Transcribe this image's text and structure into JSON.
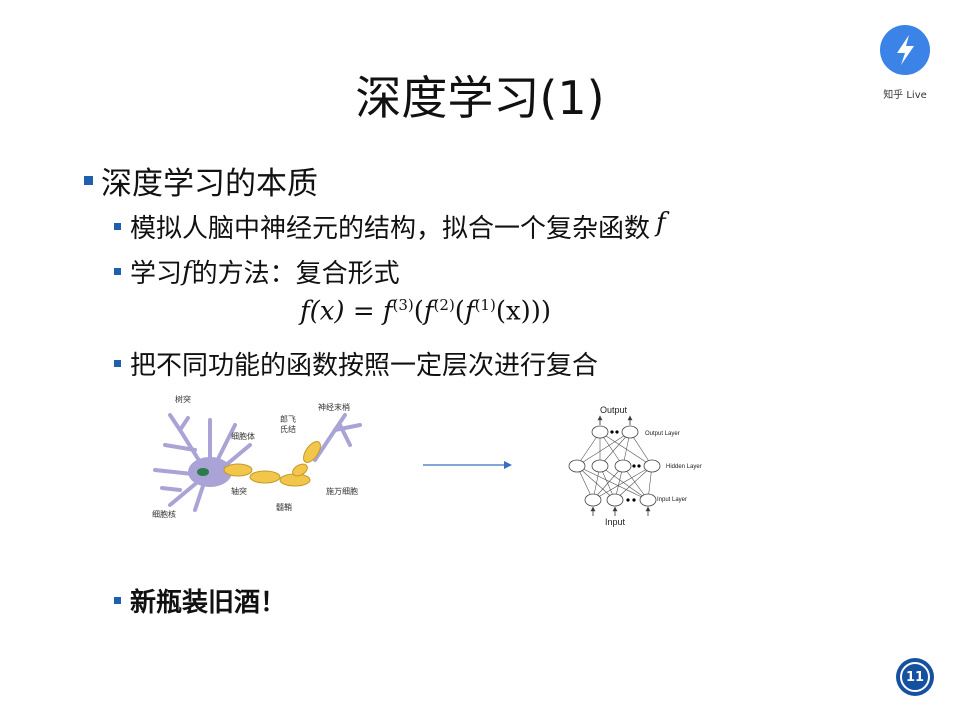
{
  "title": "深度学习(1)",
  "logo": {
    "icon": "lightning-icon",
    "text": "知乎 Live",
    "color": "#3b83e6"
  },
  "bullets": {
    "b1": "深度学习的本质",
    "b2_text": "模拟人脑中神经元的结构，拟合一个复杂函数",
    "b2_var": "f",
    "b3_pre": "学习",
    "b3_var": "f",
    "b3_post": "的方法：复合形式",
    "b4": "把不同功能的函数按照一定层次进行复合",
    "b5": "新瓶装旧酒！"
  },
  "formula": {
    "lhs": "f(x) = ",
    "f3": "f",
    "s3": "(3)",
    "f2": "f",
    "s2": "(2)",
    "f1": "f",
    "s1": "(1)",
    "tail": "(x)))"
  },
  "neuron_labels": {
    "dendrite": "树突",
    "soma": "细胞体",
    "axon": "轴突",
    "nucleus": "细胞核",
    "myelin": "髓鞘",
    "ranvier1": "郎飞",
    "ranvier2": "氏结",
    "schwann": "施万细胞",
    "terminal": "神经末梢"
  },
  "network_labels": {
    "output": "Output",
    "input": "Input",
    "output_layer": "Output Layer",
    "hidden_layer": "Hidden Layer",
    "input_layer": "Input Layer"
  },
  "page_number": "11",
  "colors": {
    "bullet": "#1f5fb0",
    "badge": "#1650a0",
    "arrow": "#3a6fc0"
  }
}
